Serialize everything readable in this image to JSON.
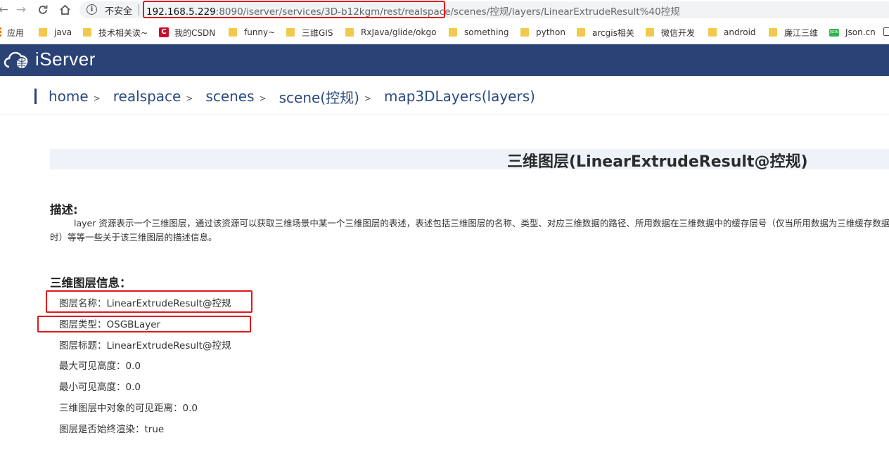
{
  "browser": {
    "security_label": "不安全",
    "url_host": "192.168.5.229",
    "url_rest": ":8090/iserver/services/3D-b12kgm/rest/realspace/scenes/控规/layers/LinearExtrudeResult%40控规"
  },
  "bookmarks": [
    {
      "label": "应用",
      "icon": "apps-icon"
    },
    {
      "label": "java",
      "icon": "folder-icon"
    },
    {
      "label": "技术相关诶~",
      "icon": "folder-icon"
    },
    {
      "label": "我的CSDN",
      "icon": "csdn-icon"
    },
    {
      "label": "funny~",
      "icon": "folder-icon"
    },
    {
      "label": "三维GIS",
      "icon": "folder-icon"
    },
    {
      "label": "RxJava/glide/okgo",
      "icon": "folder-icon"
    },
    {
      "label": "something",
      "icon": "folder-icon"
    },
    {
      "label": "python",
      "icon": "folder-icon"
    },
    {
      "label": "arcgis相关",
      "icon": "folder-icon"
    },
    {
      "label": "微信开发",
      "icon": "folder-icon"
    },
    {
      "label": "android",
      "icon": "folder-icon"
    },
    {
      "label": "廉江三维",
      "icon": "folder-icon"
    },
    {
      "label": "Json.cn",
      "icon": "json-icon"
    }
  ],
  "header": {
    "logo_text": "iServer",
    "brand_color": "#2a4275"
  },
  "breadcrumb": [
    {
      "label": "home"
    },
    {
      "label": "realspace"
    },
    {
      "label": "scenes"
    },
    {
      "label": "scene(控规)"
    },
    {
      "label": "map3DLayers(layers)"
    }
  ],
  "breadcrumb_sep": ">",
  "page": {
    "title": "三维图层(LinearExtrudeResult@控规)",
    "description_heading": "描述:",
    "description": "layer 资源表示一个三维图层，通过该资源可以获取三维场景中某一个三维图层的表述，表述包括三维图层的名称、类型、对应三维数据的路径、所用数据在三维数据中的缓存层号（仅当所用数据为三维缓存数据时）等等一些关于该三维图层的描述信息。",
    "info_heading": "三维图层信息：",
    "info_rows": [
      "图层名称：LinearExtrudeResult@控规",
      "图层类型：OSGBLayer",
      "图层标题：LinearExtrudeResult@控规",
      "最大可见高度：0.0",
      "最小可见高度：0.0",
      "三维图层中对象的可见距离：0.0",
      "图层是否始终渲染：true"
    ]
  },
  "annotation_color": "#e0191d"
}
